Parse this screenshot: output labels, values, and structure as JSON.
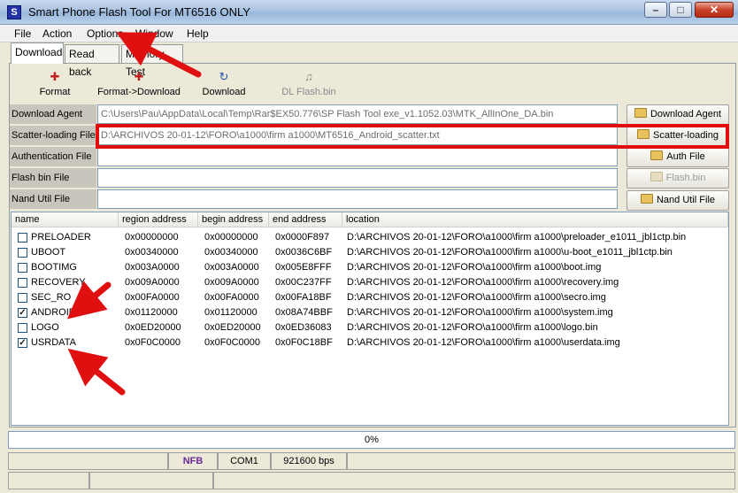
{
  "window": {
    "title": "Smart Phone Flash Tool For MT6516 ONLY",
    "app_icon_glyph": "S"
  },
  "menu": [
    "File",
    "Action",
    "Options",
    "Window",
    "Help"
  ],
  "tabs": [
    "Download",
    "Read back",
    "Memory Test"
  ],
  "toolbar": [
    {
      "label": "Format",
      "icon": "format-icon"
    },
    {
      "label": "Format->Download",
      "icon": "format-download-icon"
    },
    {
      "label": "Download",
      "icon": "download-icon"
    },
    {
      "label": "DL  Flash.bin",
      "icon": "dl-flash-icon"
    }
  ],
  "rows": [
    {
      "label": "Download Agent",
      "value": "C:\\Users\\Pau\\AppData\\Local\\Temp\\Rar$EX50.776\\SP Flash Tool exe_v1.1052.03\\MTK_AllInOne_DA.bin",
      "button": "Download Agent"
    },
    {
      "label": "Scatter-loading File",
      "value": "D:\\ARCHIVOS 20-01-12\\FORO\\a1000\\firm a1000\\MT6516_Android_scatter.txt",
      "button": "Scatter-loading"
    },
    {
      "label": "Authentication File",
      "value": "",
      "button": "Auth File"
    },
    {
      "label": "Flash bin File",
      "value": "",
      "button": "Flash.bin"
    },
    {
      "label": "Nand Util File",
      "value": "",
      "button": "Nand Util File"
    }
  ],
  "columns": [
    "name",
    "region address",
    "begin address",
    "end address",
    "location"
  ],
  "partitions": [
    {
      "name": "PRELOADER",
      "region": "0x00000000",
      "begin": "0x00000000",
      "end": "0x0000F897",
      "location": "D:\\ARCHIVOS 20-01-12\\FORO\\a1000\\firm a1000\\preloader_e1011_jbl1ctp.bin",
      "checked": false
    },
    {
      "name": "UBOOT",
      "region": "0x00340000",
      "begin": "0x00340000",
      "end": "0x0036C6BF",
      "location": "D:\\ARCHIVOS 20-01-12\\FORO\\a1000\\firm a1000\\u-boot_e1011_jbl1ctp.bin",
      "checked": false
    },
    {
      "name": "BOOTIMG",
      "region": "0x003A0000",
      "begin": "0x003A0000",
      "end": "0x005E8FFF",
      "location": "D:\\ARCHIVOS 20-01-12\\FORO\\a1000\\firm a1000\\boot.img",
      "checked": false
    },
    {
      "name": "RECOVERY",
      "region": "0x009A0000",
      "begin": "0x009A0000",
      "end": "0x00C237FF",
      "location": "D:\\ARCHIVOS 20-01-12\\FORO\\a1000\\firm a1000\\recovery.img",
      "checked": false
    },
    {
      "name": "SEC_RO",
      "region": "0x00FA0000",
      "begin": "0x00FA0000",
      "end": "0x00FA18BF",
      "location": "D:\\ARCHIVOS 20-01-12\\FORO\\a1000\\firm a1000\\secro.img",
      "checked": false
    },
    {
      "name": "ANDROID",
      "region": "0x01120000",
      "begin": "0x01120000",
      "end": "0x08A74BBF",
      "location": "D:\\ARCHIVOS 20-01-12\\FORO\\a1000\\firm a1000\\system.img",
      "checked": true
    },
    {
      "name": "LOGO",
      "region": "0x0ED20000",
      "begin": "0x0ED20000",
      "end": "0x0ED36083",
      "location": "D:\\ARCHIVOS 20-01-12\\FORO\\a1000\\firm a1000\\logo.bin",
      "checked": false
    },
    {
      "name": "USRDATA",
      "region": "0x0F0C0000",
      "begin": "0x0F0C0000",
      "end": "0x0F0C18BF",
      "location": "D:\\ARCHIVOS 20-01-12\\FORO\\a1000\\firm a1000\\userdata.img",
      "checked": true
    }
  ],
  "progress": {
    "text": "0%",
    "fraction": 0
  },
  "status": [
    "NFB",
    "COM1",
    "921600 bps"
  ],
  "colors": {
    "annotation_red": "#e01010",
    "status_nfb": "#6a2a9a"
  }
}
